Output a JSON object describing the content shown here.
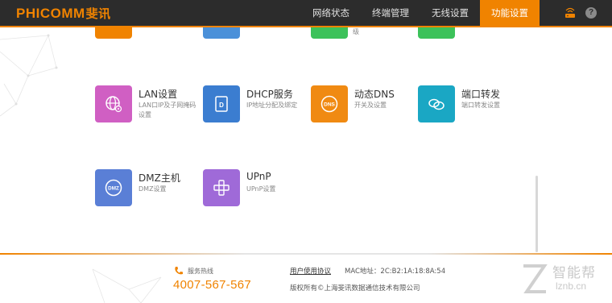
{
  "header": {
    "logo_text": "PHICOMM",
    "logo_cn": "斐讯",
    "nav": [
      {
        "label": "网络状态"
      },
      {
        "label": "终端管理"
      },
      {
        "label": "无线设置"
      },
      {
        "label": "功能设置",
        "active": true
      }
    ],
    "icons": [
      "router-icon",
      "help-icon"
    ],
    "help_glyph": "?"
  },
  "content": {
    "partial_row": {
      "colors": [
        "#f08300",
        "#4a90d9",
        "#3cc25a",
        "#3cc25a"
      ],
      "partial_desc": "级"
    },
    "items": [
      {
        "title": "LAN设置",
        "desc": "LAN口IP及子网掩码设置",
        "color": "#d05fc3",
        "icon": "globe-settings-icon"
      },
      {
        "title": "DHCP服务",
        "desc": "IP地址分配及绑定",
        "color": "#3b7dd0",
        "icon": "dhcp-document-icon"
      },
      {
        "title": "动态DNS",
        "desc": "开关及设置",
        "color": "#f08a12",
        "icon": "dns-icon"
      },
      {
        "title": "端口转发",
        "desc": "端口转发设置",
        "color": "#1aa7c4",
        "icon": "port-forward-icon"
      },
      {
        "title": "DMZ主机",
        "desc": "DMZ设置",
        "color": "#5a7fd6",
        "icon": "dmz-icon"
      },
      {
        "title": "UPnP",
        "desc": "UPnP设置",
        "color": "#9f6ad8",
        "icon": "upnp-icon"
      }
    ],
    "dns_glyph": "DNS",
    "dmz_glyph": "DMZ"
  },
  "footer": {
    "hotline_label": "服务热线",
    "hotline_number": "4007-567-567",
    "agreement": "用户使用协议",
    "mac": "MAC地址：2C:B2:1A:18:8A:54",
    "copyright": "版权所有©上海斐讯数据通信技术有限公司",
    "watermark_cn": "智能帮",
    "watermark_en": "lznb.cn"
  },
  "colors": {
    "accent": "#f08300",
    "header_bg": "#2c2c2c"
  }
}
